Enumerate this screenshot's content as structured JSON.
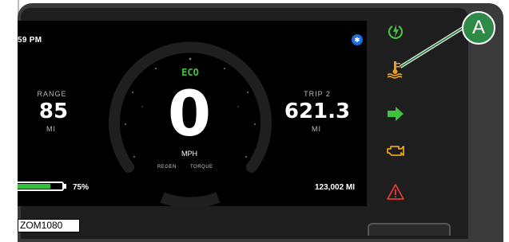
{
  "status": {
    "clock": "59 PM",
    "bluetooth_icon": "bluetooth-icon"
  },
  "range": {
    "label": "RANGE",
    "value": "85",
    "unit": "MI"
  },
  "trip": {
    "label": "TRIP 2",
    "value": "621.3",
    "unit": "MI"
  },
  "speedometer": {
    "mode": "ECO",
    "speed": "0",
    "unit": "MPH",
    "regen_label": "REGEN",
    "torque_label": "TORQUE"
  },
  "battery": {
    "percent_label": "75%",
    "fraction": 0.75,
    "color": "#33c13a"
  },
  "odometer": {
    "value": "123,002 MI"
  },
  "indicators": [
    {
      "name": "power-ready-icon",
      "color": "#3fc33f"
    },
    {
      "name": "coolant-temperature-icon",
      "color": "#e7a11b"
    },
    {
      "name": "direction-arrow-icon",
      "color": "#3fc33f"
    },
    {
      "name": "check-engine-icon",
      "color": "#e7a11b"
    },
    {
      "name": "warning-triangle-icon",
      "color": "#e53935"
    }
  ],
  "callout": {
    "letter": "A",
    "color": "#2f8a47"
  },
  "doc_code": "ZOM1080"
}
